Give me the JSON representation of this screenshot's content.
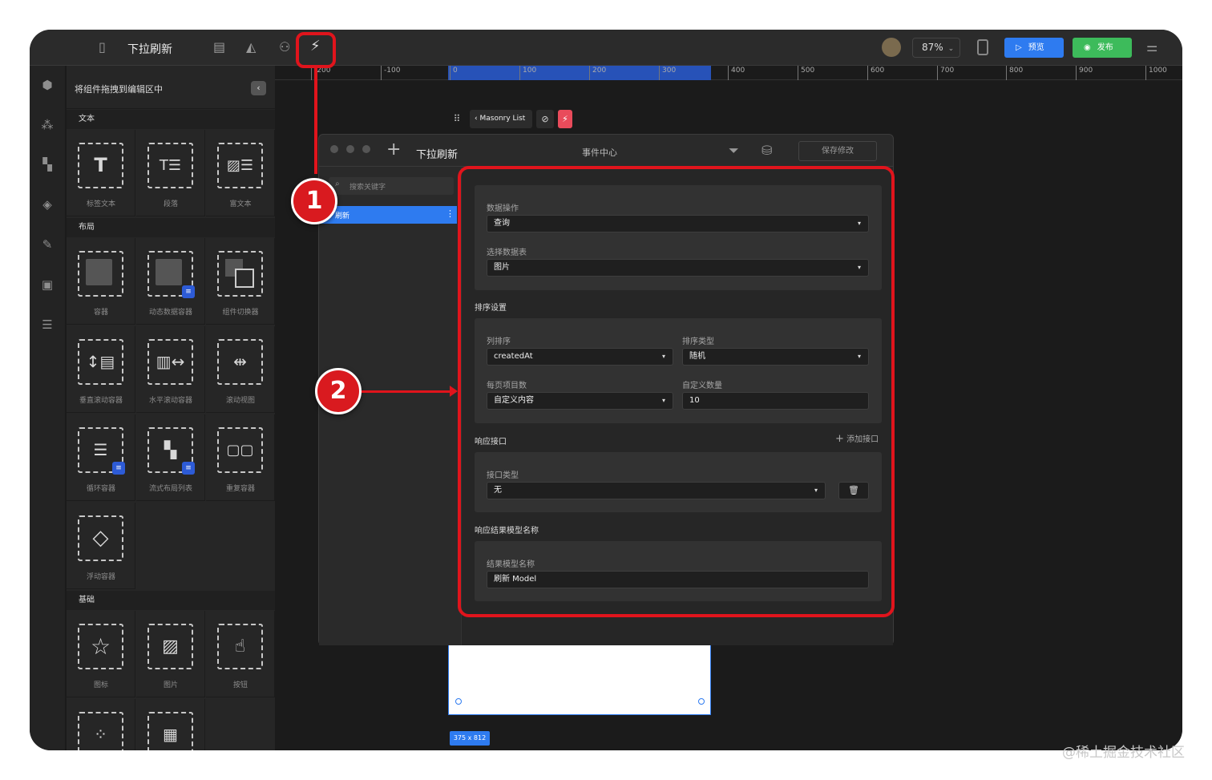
{
  "topbar": {
    "title": "下拉刷新",
    "zoom": "87%",
    "preview_label": "预览",
    "publish_label": "发布"
  },
  "panel": {
    "header": "将组件拖拽到编辑区中",
    "sections": {
      "text": "文本",
      "layout": "布局",
      "basic": "基础"
    },
    "text_items": [
      "标签文本",
      "段落",
      "富文本"
    ],
    "layout_items": [
      "容器",
      "动态数据容器",
      "组件切换器",
      "垂直滚动容器",
      "水平滚动容器",
      "滚动视图",
      "循环容器",
      "流式布局列表",
      "重复容器",
      "浮动容器"
    ],
    "basic_items": [
      "图标",
      "图片",
      "按钮"
    ]
  },
  "ruler": {
    "ticks": [
      "-200",
      "-100",
      "0",
      "100",
      "200",
      "300",
      "400",
      "500",
      "600",
      "700",
      "800",
      "900",
      "1000"
    ]
  },
  "breadcrumb": {
    "component": "Masonry List"
  },
  "dialog": {
    "title": "下拉刷新",
    "center_title": "事件中心",
    "save_label": "保存修改",
    "search_placeholder": "搜索关键字",
    "list_item": "刷新",
    "data_op_label": "数据操作",
    "data_op_value": "查询",
    "table_label": "选择数据表",
    "table_value": "图片",
    "sort_heading": "排序设置",
    "sort_col_label": "列排序",
    "sort_col_value": "createdAt",
    "sort_type_label": "排序类型",
    "sort_type_value": "随机",
    "page_count_label": "每页项目数",
    "page_count_value": "自定义内容",
    "custom_count_label": "自定义数量",
    "custom_count_value": "10",
    "resp_heading": "响应接口",
    "add_api_label": "添加接口",
    "api_type_label": "接口类型",
    "api_type_value": "无",
    "model_heading": "响应结果模型名称",
    "model_label": "结果模型名称",
    "model_value": "刷新 Model"
  },
  "annotations": {
    "badge1": "1",
    "badge2": "2"
  },
  "frame_size": "375 x 812",
  "watermark": "@稀土掘金技术社区",
  "colors": {
    "accent_blue": "#2e7bf0",
    "publish_green": "#3dbb5b",
    "annotation_red": "#e0141c"
  }
}
